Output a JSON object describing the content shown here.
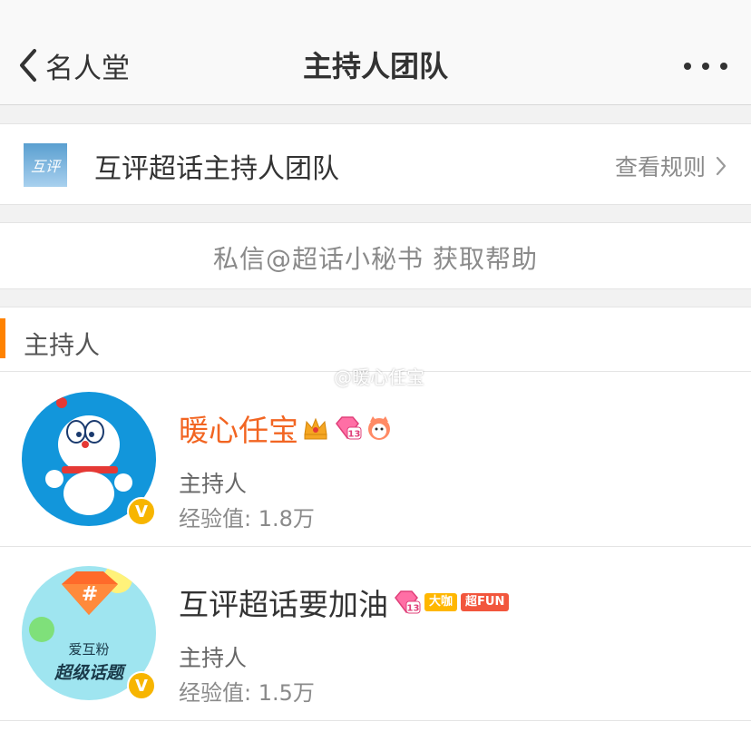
{
  "nav": {
    "back_label": "名人堂",
    "title": "主持人团队",
    "more_icon": "more-dots-icon"
  },
  "team": {
    "logo_text": "互评",
    "name": "互评超话主持人团队",
    "rules_label": "查看规则"
  },
  "help": {
    "text": "私信@超话小秘书 获取帮助"
  },
  "section": {
    "title": "主持人",
    "accent_color": "#ff8200"
  },
  "hosts": [
    {
      "name": "暖心任宝",
      "name_color": "#f26522",
      "badges": [
        "crown-icon",
        "level-13-gem-icon",
        "cat-face-icon"
      ],
      "role": "主持人",
      "exp": "经验值: 1.8万",
      "verified": "V"
    },
    {
      "name": "互评超话要加油",
      "name_color": "#333333",
      "badges": [
        "level-13-gem-icon",
        "大咖",
        "超FUN"
      ],
      "avatar_text_top": "爱互粉",
      "avatar_text_bottom": "超级话题",
      "role": "主持人",
      "exp": "经验值: 1.5万",
      "verified": "V"
    }
  ],
  "watermark": "@暖心任宝",
  "colors": {
    "accent": "#ff8200",
    "verified": "#f7b500"
  }
}
